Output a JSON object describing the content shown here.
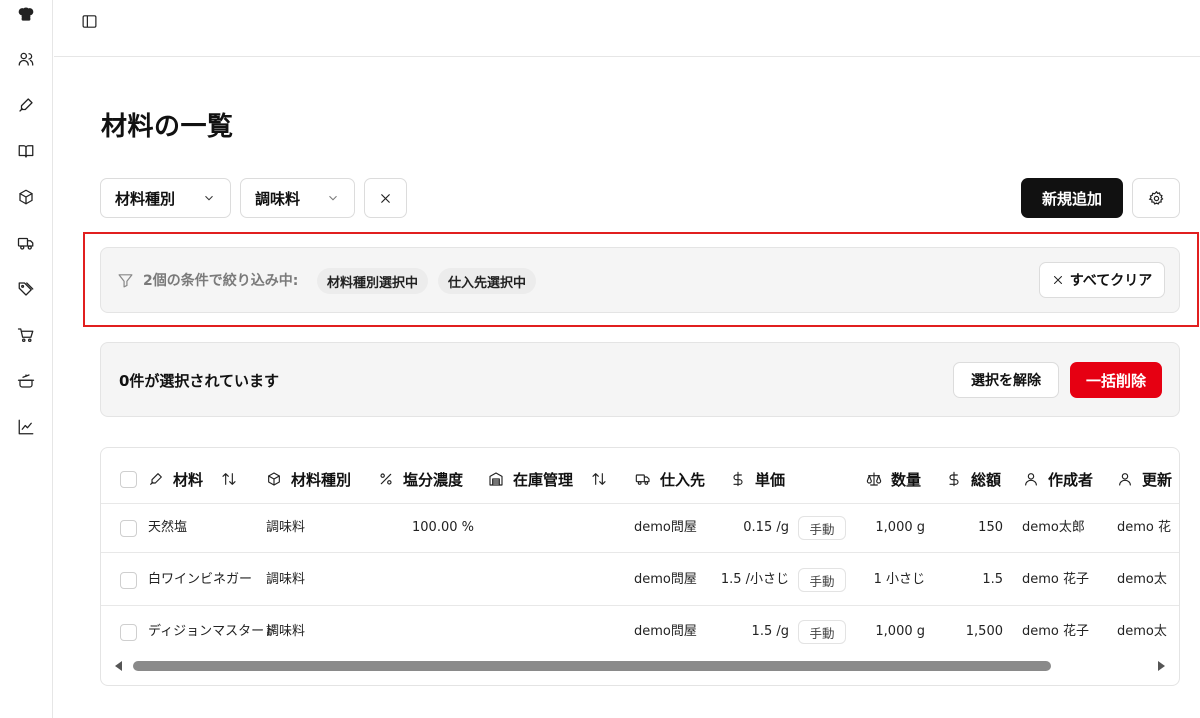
{
  "page": {
    "title": "材料の一覧"
  },
  "filters": {
    "type_select": "材料種別",
    "category_select": "調味料",
    "add_button": "新規追加"
  },
  "filter_banner": {
    "summary": "2個の条件で絞り込み中:",
    "chips": [
      "材料種別選択中",
      "仕入先選択中"
    ],
    "clear_all": "すべてクリア"
  },
  "selection": {
    "count_text": "0件が選択されています",
    "deselect": "選択を解除",
    "bulk_delete": "一括削除"
  },
  "table": {
    "columns": {
      "material": "材料",
      "type": "材料種別",
      "salt": "塩分濃度",
      "stock": "在庫管理",
      "supplier": "仕入先",
      "price": "単価",
      "qty": "数量",
      "total": "総額",
      "creator": "作成者",
      "updater": "更新"
    },
    "rows": [
      {
        "material": "天然塩",
        "type": "調味料",
        "salt": "100.00 %",
        "supplier": "demo問屋",
        "price": "0.15 /g",
        "price_mode": "手動",
        "qty": "1,000 g",
        "total": "150",
        "creator": "demo太郎",
        "updater": "demo 花"
      },
      {
        "material": "白ワインビネガー",
        "type": "調味料",
        "salt": "",
        "supplier": "demo問屋",
        "price": "1.5 /小さじ",
        "price_mode": "手動",
        "qty": "1 小さじ",
        "total": "1.5",
        "creator": "demo 花子",
        "updater": "demo太"
      },
      {
        "material": "ディジョンマスタード",
        "type": "調味料",
        "salt": "",
        "supplier": "demo問屋",
        "price": "1.5 /g",
        "price_mode": "手動",
        "qty": "1,000 g",
        "total": "1,500",
        "creator": "demo 花子",
        "updater": "demo太"
      }
    ]
  },
  "colors": {
    "highlight": "#e11f1f",
    "danger": "#e60012",
    "primary": "#111111"
  }
}
